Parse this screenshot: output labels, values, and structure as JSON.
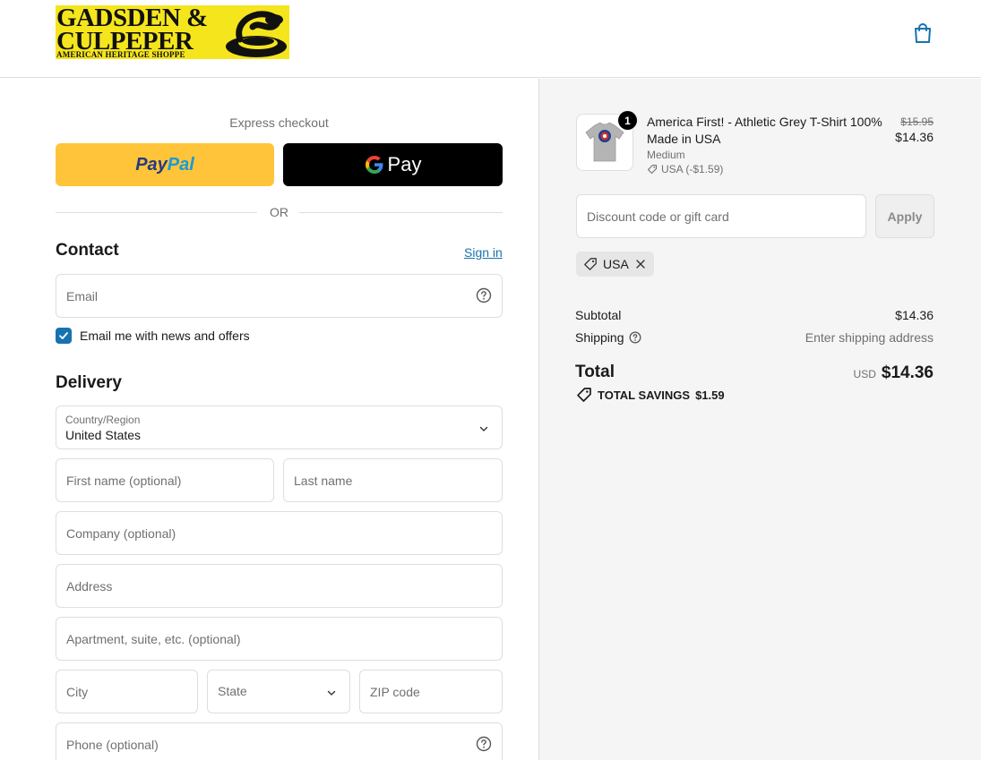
{
  "brand": {
    "logo_line1": "GADSDEN &",
    "logo_line2": "CULPEPER",
    "logo_line3": "AMERICAN HERITAGE SHOPPE"
  },
  "express": {
    "title": "Express checkout",
    "paypal_part1": "Pay",
    "paypal_part2": "Pal",
    "gpay_label": "Pay",
    "or_label": "OR"
  },
  "contact": {
    "title": "Contact",
    "signin_label": "Sign in",
    "email_placeholder": "Email",
    "newsletter_label": "Email me with news and offers",
    "newsletter_checked": true
  },
  "delivery": {
    "title": "Delivery",
    "country_label": "Country/Region",
    "country_value": "United States",
    "first_name_placeholder": "First name (optional)",
    "last_name_placeholder": "Last name",
    "company_placeholder": "Company (optional)",
    "address_placeholder": "Address",
    "apartment_placeholder": "Apartment, suite, etc. (optional)",
    "city_placeholder": "City",
    "state_placeholder": "State",
    "zip_placeholder": "ZIP code",
    "phone_placeholder": "Phone (optional)"
  },
  "order": {
    "item": {
      "quantity": "1",
      "name": "America First! - Athletic Grey T-Shirt 100% Made in USA",
      "variant": "Medium",
      "discount": "USA (-$1.59)",
      "original_price": "$15.95",
      "price": "$14.36"
    },
    "discount_placeholder": "Discount code or gift card",
    "apply_label": "Apply",
    "applied_code": "USA",
    "subtotal_label": "Subtotal",
    "subtotal_value": "$14.36",
    "shipping_label": "Shipping",
    "shipping_value": "Enter shipping address",
    "total_label": "Total",
    "total_currency": "USD",
    "total_value": "$14.36",
    "savings_label": "TOTAL SAVINGS",
    "savings_value": "$1.59"
  },
  "colors": {
    "accent_blue": "#1773b0",
    "paypal_yellow": "#ffc439",
    "logo_yellow": "#f5e51d"
  }
}
